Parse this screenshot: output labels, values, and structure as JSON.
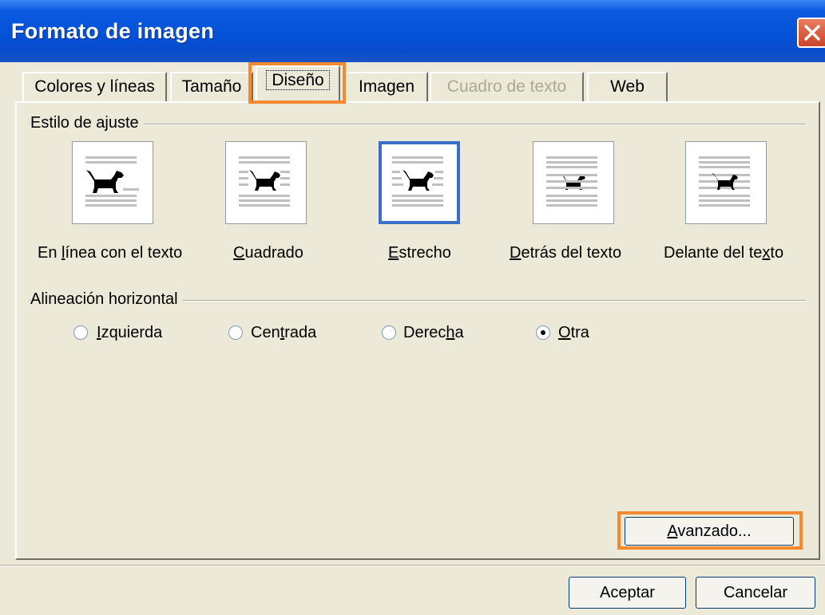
{
  "window": {
    "title": "Formato de imagen"
  },
  "tabs": [
    {
      "label": "Colores y líneas"
    },
    {
      "label": "Tamaño"
    },
    {
      "label": "Diseño"
    },
    {
      "label": "Imagen"
    },
    {
      "label": "Cuadro de texto"
    },
    {
      "label": "Web"
    }
  ],
  "wrap_style": {
    "group_label": "Estilo de ajuste",
    "options": [
      {
        "pre": "En ",
        "u": "l",
        "post": "ínea con el texto"
      },
      {
        "pre": "",
        "u": "C",
        "post": "uadrado"
      },
      {
        "pre": "",
        "u": "E",
        "post": "strecho"
      },
      {
        "pre": "",
        "u": "D",
        "post": "etrás del texto"
      },
      {
        "pre": "Delante del te",
        "u": "x",
        "post": "to"
      }
    ]
  },
  "alignment": {
    "group_label": "Alineación horizontal",
    "options": [
      {
        "pre": "",
        "u": "I",
        "post": "zquierda"
      },
      {
        "pre": "Cen",
        "u": "t",
        "post": "rada"
      },
      {
        "pre": "Derec",
        "u": "h",
        "post": "a"
      },
      {
        "pre": "",
        "u": "O",
        "post": "tra"
      }
    ]
  },
  "buttons": {
    "advanced": {
      "pre": "",
      "u": "A",
      "post": "vanzado..."
    },
    "accept": "Aceptar",
    "cancel": "Cancelar"
  },
  "colors": {
    "highlight": "#f5892f",
    "titlebar": "#0351d6",
    "selection": "#3a6fc7"
  },
  "icons": {
    "close": "close-icon",
    "dog": "dog-icon"
  }
}
